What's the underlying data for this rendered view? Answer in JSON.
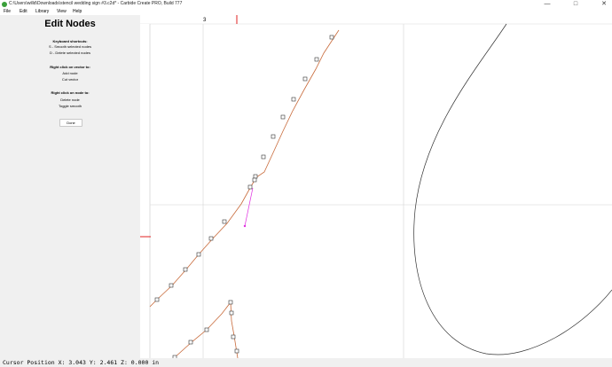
{
  "window": {
    "title": "C:\\Users\\willd\\Downloads\\stencil wedding sign #3.c2d* - Carbide Create PRO, Build 777",
    "minimize_icon": "minimize-icon",
    "maximize_icon": "maximize-icon",
    "close_icon": "close-icon"
  },
  "menu": [
    "File",
    "Edit",
    "Library",
    "View",
    "Help"
  ],
  "sidebar": {
    "title": "Edit Nodes",
    "shortcuts_title": "Keyboard shortcuts:",
    "shortcut_smooth": "S - Smooth selected nodes",
    "shortcut_delete": "D - Delete selected nodes",
    "vector_title": "Right click on vector to:",
    "vector_add": "Add node",
    "vector_cut": "Cut vector",
    "node_title": "Right click on node to:",
    "node_delete": "Delete node",
    "node_toggle": "Toggle smooth",
    "done_label": "Done"
  },
  "ruler": {
    "label": "3"
  },
  "status": {
    "text": "Cursor Position X: 3.043 Y: 2.461 Z: 0.000 in"
  },
  "colors": {
    "path": "#c86a3a",
    "handle": "#e030e0",
    "marker": "#e02020",
    "grid": "#d4d4d4"
  }
}
